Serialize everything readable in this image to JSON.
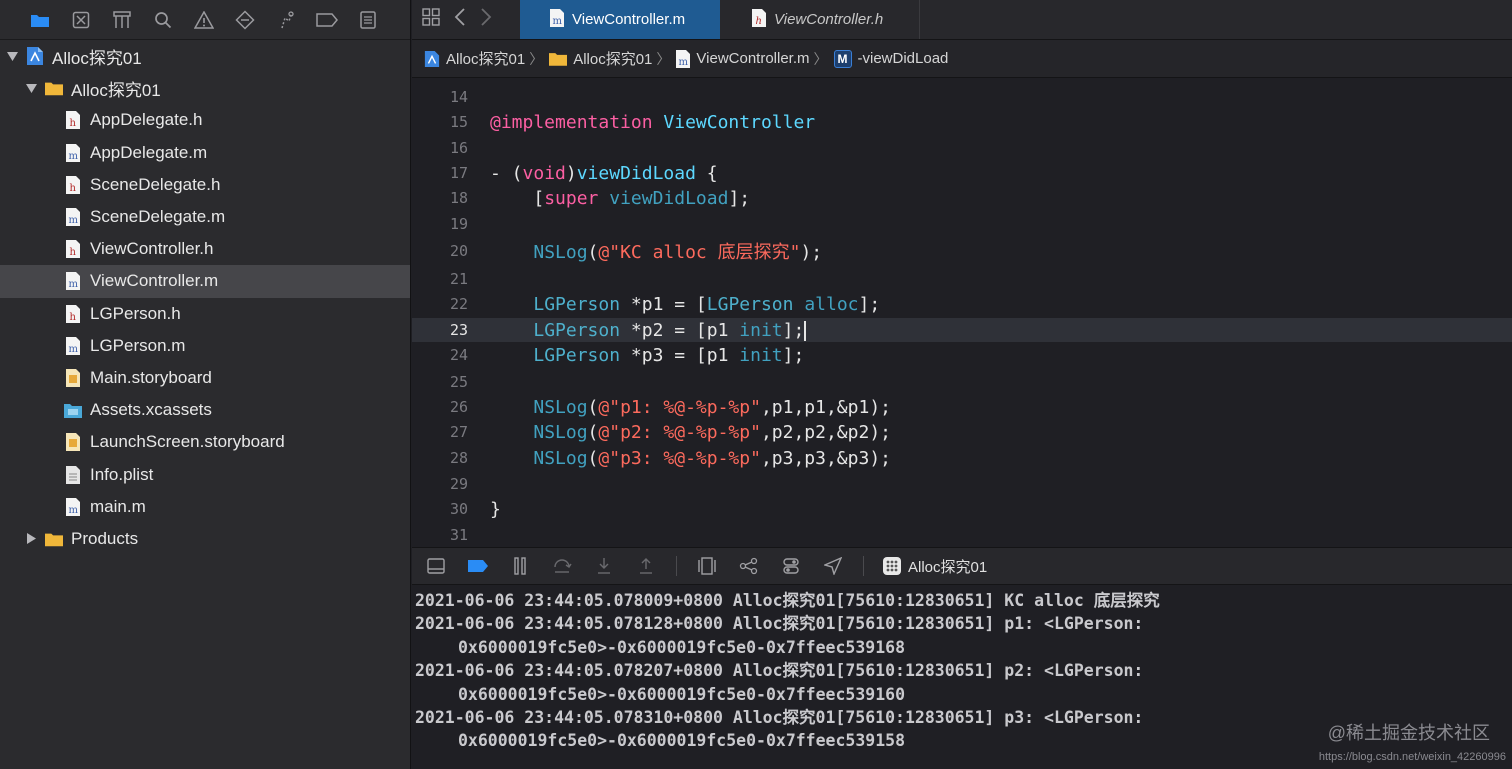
{
  "navigator": {
    "toolbar_icons": [
      "folder-icon",
      "source-control-icon",
      "hierarchy-icon",
      "search-icon",
      "warning-icon",
      "test-icon",
      "debug-icon",
      "breakpoint-icon",
      "report-icon"
    ],
    "project": "Alloc探究01",
    "group": "Alloc探究01",
    "files": [
      {
        "name": "AppDelegate.h",
        "type": "h"
      },
      {
        "name": "AppDelegate.m",
        "type": "m"
      },
      {
        "name": "SceneDelegate.h",
        "type": "h"
      },
      {
        "name": "SceneDelegate.m",
        "type": "m"
      },
      {
        "name": "ViewController.h",
        "type": "h"
      },
      {
        "name": "ViewController.m",
        "type": "m"
      },
      {
        "name": "LGPerson.h",
        "type": "h"
      },
      {
        "name": "LGPerson.m",
        "type": "m"
      },
      {
        "name": "Main.storyboard",
        "type": "storyboard"
      },
      {
        "name": "Assets.xcassets",
        "type": "assets"
      },
      {
        "name": "LaunchScreen.storyboard",
        "type": "storyboard"
      },
      {
        "name": "Info.plist",
        "type": "plist"
      },
      {
        "name": "main.m",
        "type": "m"
      }
    ],
    "products": "Products"
  },
  "tabs": {
    "active": "ViewController.m",
    "inactive": "ViewController.h"
  },
  "jumpbar": {
    "project": "Alloc探究01",
    "group": "Alloc探究01",
    "file": "ViewController.m",
    "method_badge": "M",
    "method": "-viewDidLoad"
  },
  "code": {
    "line_numbers": [
      "14",
      "15",
      "16",
      "17",
      "18",
      "19",
      "20",
      "21",
      "22",
      "23",
      "24",
      "25",
      "26",
      "27",
      "28",
      "29",
      "30",
      "31"
    ],
    "current_line": "23",
    "lines": {
      "l15_kw": "@implementation",
      "l15_cls": "ViewController",
      "l17_a": "- (",
      "l17_kw": "void",
      "l17_b": ")",
      "l17_fn": "viewDidLoad",
      "l17_c": " {",
      "l18_a": "[",
      "l18_kw": "super",
      "l18_fn": "viewDidLoad",
      "l18_b": "];",
      "l20_fn": "NSLog",
      "l20_a": "(",
      "l20_str": "@\"KC alloc 底层探究\"",
      "l20_b": ");",
      "l22_tp": "LGPerson",
      "l22_a": " *p1 = [",
      "l22_tp2": "LGPerson",
      "l22_msg": "alloc",
      "l22_b": "];",
      "l23_tp": "LGPerson",
      "l23_a": " *p2 = [p1 ",
      "l23_msg": "init",
      "l23_b": "];",
      "l24_tp": "LGPerson",
      "l24_a": " *p3 = [p1 ",
      "l24_msg": "init",
      "l24_b": "];",
      "l26_fn": "NSLog",
      "l26_str": "@\"p1: %@-%p-%p\"",
      "l26_b": ",p1,p1,&p1);",
      "l27_fn": "NSLog",
      "l27_str": "@\"p2: %@-%p-%p\"",
      "l27_b": ",p2,p2,&p2);",
      "l28_fn": "NSLog",
      "l28_str": "@\"p3: %@-%p-%p\"",
      "l28_b": ",p3,p3,&p3);",
      "l30": "}"
    }
  },
  "debugbar": {
    "scheme": "Alloc探究01"
  },
  "console": {
    "lines": [
      "2021-06-06 23:44:05.078009+0800 Alloc探究01[75610:12830651] KC alloc 底层探究",
      "2021-06-06 23:44:05.078128+0800 Alloc探究01[75610:12830651] p1: <LGPerson:",
      "0x6000019fc5e0>-0x6000019fc5e0-0x7ffeec539168",
      "2021-06-06 23:44:05.078207+0800 Alloc探究01[75610:12830651] p2: <LGPerson:",
      "0x6000019fc5e0>-0x6000019fc5e0-0x7ffeec539160",
      "2021-06-06 23:44:05.078310+0800 Alloc探究01[75610:12830651] p3: <LGPerson:",
      "0x6000019fc5e0>-0x6000019fc5e0-0x7ffeec539158"
    ]
  },
  "watermark": "@稀土掘金技术社区",
  "watermark_url": "https://blog.csdn.net/weixin_42260996",
  "colors": {
    "accent": "#1f5b92",
    "keyword": "#fc5fa3",
    "string": "#fc6a5d",
    "type": "#4eb0cc"
  }
}
